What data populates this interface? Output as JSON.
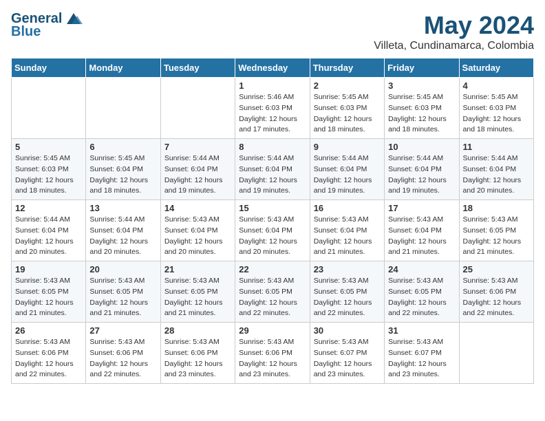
{
  "header": {
    "logo_general": "General",
    "logo_blue": "Blue",
    "title": "May 2024",
    "subtitle": "Villeta, Cundinamarca, Colombia"
  },
  "weekdays": [
    "Sunday",
    "Monday",
    "Tuesday",
    "Wednesday",
    "Thursday",
    "Friday",
    "Saturday"
  ],
  "weeks": [
    [
      {
        "day": "",
        "info": ""
      },
      {
        "day": "",
        "info": ""
      },
      {
        "day": "",
        "info": ""
      },
      {
        "day": "1",
        "info": "Sunrise: 5:46 AM\nSunset: 6:03 PM\nDaylight: 12 hours\nand 17 minutes."
      },
      {
        "day": "2",
        "info": "Sunrise: 5:45 AM\nSunset: 6:03 PM\nDaylight: 12 hours\nand 18 minutes."
      },
      {
        "day": "3",
        "info": "Sunrise: 5:45 AM\nSunset: 6:03 PM\nDaylight: 12 hours\nand 18 minutes."
      },
      {
        "day": "4",
        "info": "Sunrise: 5:45 AM\nSunset: 6:03 PM\nDaylight: 12 hours\nand 18 minutes."
      }
    ],
    [
      {
        "day": "5",
        "info": "Sunrise: 5:45 AM\nSunset: 6:03 PM\nDaylight: 12 hours\nand 18 minutes."
      },
      {
        "day": "6",
        "info": "Sunrise: 5:45 AM\nSunset: 6:04 PM\nDaylight: 12 hours\nand 18 minutes."
      },
      {
        "day": "7",
        "info": "Sunrise: 5:44 AM\nSunset: 6:04 PM\nDaylight: 12 hours\nand 19 minutes."
      },
      {
        "day": "8",
        "info": "Sunrise: 5:44 AM\nSunset: 6:04 PM\nDaylight: 12 hours\nand 19 minutes."
      },
      {
        "day": "9",
        "info": "Sunrise: 5:44 AM\nSunset: 6:04 PM\nDaylight: 12 hours\nand 19 minutes."
      },
      {
        "day": "10",
        "info": "Sunrise: 5:44 AM\nSunset: 6:04 PM\nDaylight: 12 hours\nand 19 minutes."
      },
      {
        "day": "11",
        "info": "Sunrise: 5:44 AM\nSunset: 6:04 PM\nDaylight: 12 hours\nand 20 minutes."
      }
    ],
    [
      {
        "day": "12",
        "info": "Sunrise: 5:44 AM\nSunset: 6:04 PM\nDaylight: 12 hours\nand 20 minutes."
      },
      {
        "day": "13",
        "info": "Sunrise: 5:44 AM\nSunset: 6:04 PM\nDaylight: 12 hours\nand 20 minutes."
      },
      {
        "day": "14",
        "info": "Sunrise: 5:43 AM\nSunset: 6:04 PM\nDaylight: 12 hours\nand 20 minutes."
      },
      {
        "day": "15",
        "info": "Sunrise: 5:43 AM\nSunset: 6:04 PM\nDaylight: 12 hours\nand 20 minutes."
      },
      {
        "day": "16",
        "info": "Sunrise: 5:43 AM\nSunset: 6:04 PM\nDaylight: 12 hours\nand 21 minutes."
      },
      {
        "day": "17",
        "info": "Sunrise: 5:43 AM\nSunset: 6:04 PM\nDaylight: 12 hours\nand 21 minutes."
      },
      {
        "day": "18",
        "info": "Sunrise: 5:43 AM\nSunset: 6:05 PM\nDaylight: 12 hours\nand 21 minutes."
      }
    ],
    [
      {
        "day": "19",
        "info": "Sunrise: 5:43 AM\nSunset: 6:05 PM\nDaylight: 12 hours\nand 21 minutes."
      },
      {
        "day": "20",
        "info": "Sunrise: 5:43 AM\nSunset: 6:05 PM\nDaylight: 12 hours\nand 21 minutes."
      },
      {
        "day": "21",
        "info": "Sunrise: 5:43 AM\nSunset: 6:05 PM\nDaylight: 12 hours\nand 21 minutes."
      },
      {
        "day": "22",
        "info": "Sunrise: 5:43 AM\nSunset: 6:05 PM\nDaylight: 12 hours\nand 22 minutes."
      },
      {
        "day": "23",
        "info": "Sunrise: 5:43 AM\nSunset: 6:05 PM\nDaylight: 12 hours\nand 22 minutes."
      },
      {
        "day": "24",
        "info": "Sunrise: 5:43 AM\nSunset: 6:05 PM\nDaylight: 12 hours\nand 22 minutes."
      },
      {
        "day": "25",
        "info": "Sunrise: 5:43 AM\nSunset: 6:06 PM\nDaylight: 12 hours\nand 22 minutes."
      }
    ],
    [
      {
        "day": "26",
        "info": "Sunrise: 5:43 AM\nSunset: 6:06 PM\nDaylight: 12 hours\nand 22 minutes."
      },
      {
        "day": "27",
        "info": "Sunrise: 5:43 AM\nSunset: 6:06 PM\nDaylight: 12 hours\nand 22 minutes."
      },
      {
        "day": "28",
        "info": "Sunrise: 5:43 AM\nSunset: 6:06 PM\nDaylight: 12 hours\nand 23 minutes."
      },
      {
        "day": "29",
        "info": "Sunrise: 5:43 AM\nSunset: 6:06 PM\nDaylight: 12 hours\nand 23 minutes."
      },
      {
        "day": "30",
        "info": "Sunrise: 5:43 AM\nSunset: 6:07 PM\nDaylight: 12 hours\nand 23 minutes."
      },
      {
        "day": "31",
        "info": "Sunrise: 5:43 AM\nSunset: 6:07 PM\nDaylight: 12 hours\nand 23 minutes."
      },
      {
        "day": "",
        "info": ""
      }
    ]
  ]
}
